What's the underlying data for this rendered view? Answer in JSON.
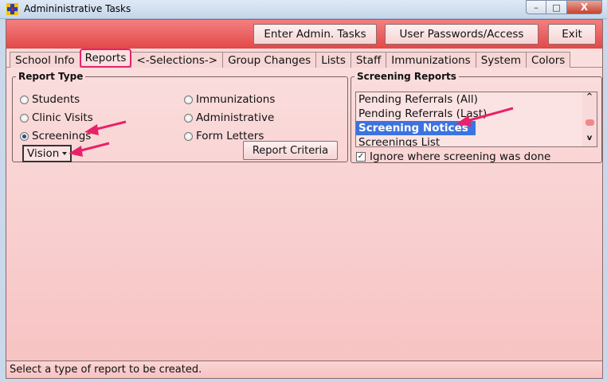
{
  "window": {
    "title": "Admininistrative Tasks",
    "min_glyph": "–",
    "max_glyph": "□",
    "close_glyph": "X"
  },
  "toolbar": {
    "enter_admin": "Enter Admin. Tasks",
    "passwords": "User Passwords/Access",
    "exit": "Exit"
  },
  "tabs": [
    "School Info",
    "Reports",
    "<-Selections->",
    "Group Changes",
    "Lists",
    "Staff",
    "Immunizations",
    "System",
    "Colors"
  ],
  "report_type": {
    "legend": "Report Type",
    "options": [
      "Students",
      "Clinic Visits",
      "Screenings",
      "Immunizations",
      "Administrative",
      "Form Letters"
    ],
    "selected": "Screenings",
    "screening_kind": "Vision",
    "criteria_button": "Report Criteria"
  },
  "screening_reports": {
    "legend": "Screening Reports",
    "items": [
      "Pending Referrals (All)",
      "Pending Referrals (Last)",
      "Screening Notices",
      "Screenings List"
    ],
    "selected": "Screening Notices",
    "scroll_up": "^",
    "scroll_down": "v",
    "ignore_label": "Ignore where screening was done",
    "ignore_checked": true,
    "check_glyph": "✓"
  },
  "status": "Select a type of report to be created.",
  "colors": {
    "annotation": "#e8216a",
    "selection": "#3b74e0",
    "header": "#e24848"
  }
}
